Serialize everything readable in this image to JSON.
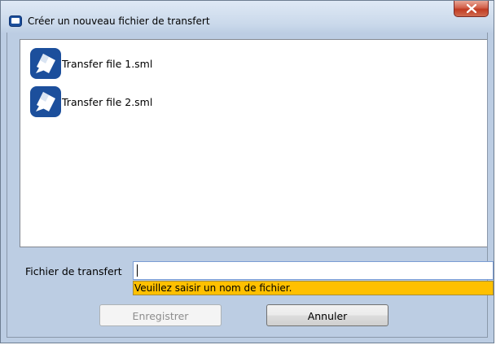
{
  "window": {
    "title": "Créer un nouveau fichier de transfert",
    "close_glyph": "x"
  },
  "files": [
    {
      "name": "Transfer file 1.sml",
      "icon": "transfer-file-icon"
    },
    {
      "name": "Transfer file 2.sml",
      "icon": "transfer-file-icon"
    }
  ],
  "form": {
    "label": "Fichier de transfert",
    "value": "",
    "validation_message": "Veuillez saisir un nom de fichier."
  },
  "buttons": {
    "save_label": "Enregistrer",
    "save_enabled": false,
    "cancel_label": "Annuler"
  },
  "colors": {
    "validation_bg": "#ffc000",
    "icon_blue": "#1c4f9c",
    "close_red": "#c13b22"
  }
}
